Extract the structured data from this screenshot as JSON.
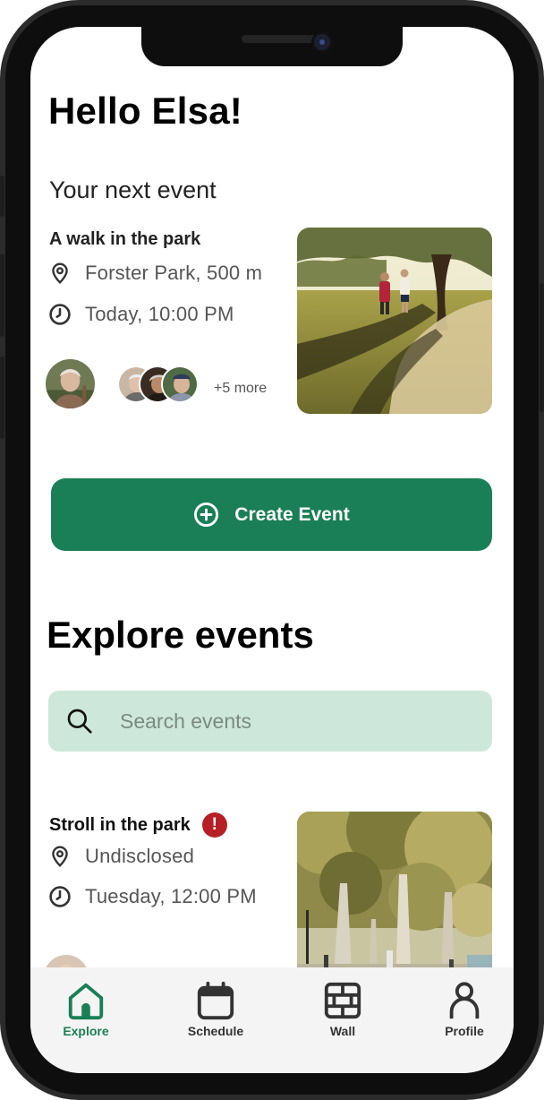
{
  "greeting": "Hello Elsa!",
  "next_event": {
    "heading": "Your next event",
    "title": "A walk in the park",
    "location": "Forster Park, 500 m",
    "time": "Today, 10:00 PM",
    "more": "+5 more"
  },
  "create_button": {
    "label": "Create Event"
  },
  "explore": {
    "heading": "Explore events",
    "search_placeholder": "Search events",
    "events": [
      {
        "title": "Stroll in the park",
        "alert": "!",
        "location": "Undisclosed",
        "time": "Tuesday, 12:00 PM"
      }
    ]
  },
  "tabs": [
    {
      "label": "Explore",
      "icon": "home-icon",
      "active": true
    },
    {
      "label": "Schedule",
      "icon": "calendar-icon",
      "active": false
    },
    {
      "label": "Wall",
      "icon": "brick-wall-icon",
      "active": false
    },
    {
      "label": "Profile",
      "icon": "person-icon",
      "active": false
    }
  ],
  "colors": {
    "brand": "#1a7f56",
    "search_bg": "#cde8da",
    "alert": "#b51f25"
  }
}
